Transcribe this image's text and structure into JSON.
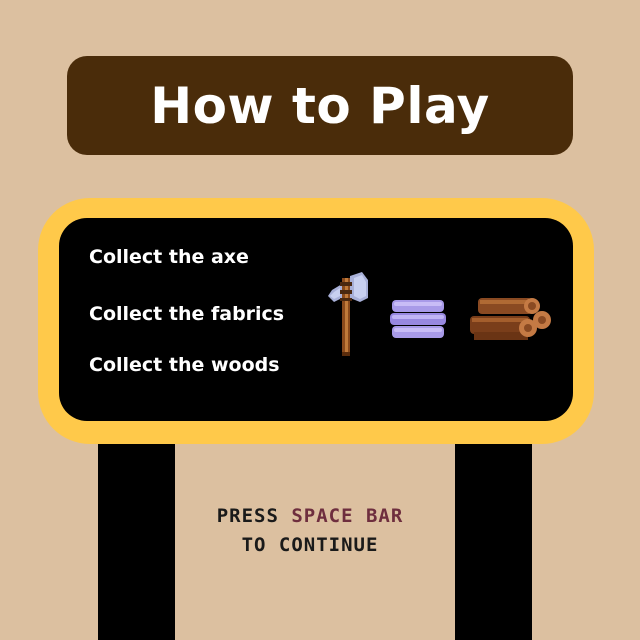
{
  "title": "How to Play",
  "instructions": [
    "Collect the axe",
    "Collect the fabrics",
    "Collect the woods"
  ],
  "items": [
    {
      "icon": "axe-icon"
    },
    {
      "icon": "fabric-icon"
    },
    {
      "icon": "woods-icon"
    }
  ],
  "prompt": {
    "press": "PRESS",
    "key": "SPACE BAR",
    "continue": "TO CONTINUE"
  },
  "colors": {
    "background": "#dcc0a0",
    "title_bar": "#4a2c0a",
    "board_frame": "#ffc94a",
    "board": "#000000",
    "key_highlight": "#6e2e3e"
  }
}
